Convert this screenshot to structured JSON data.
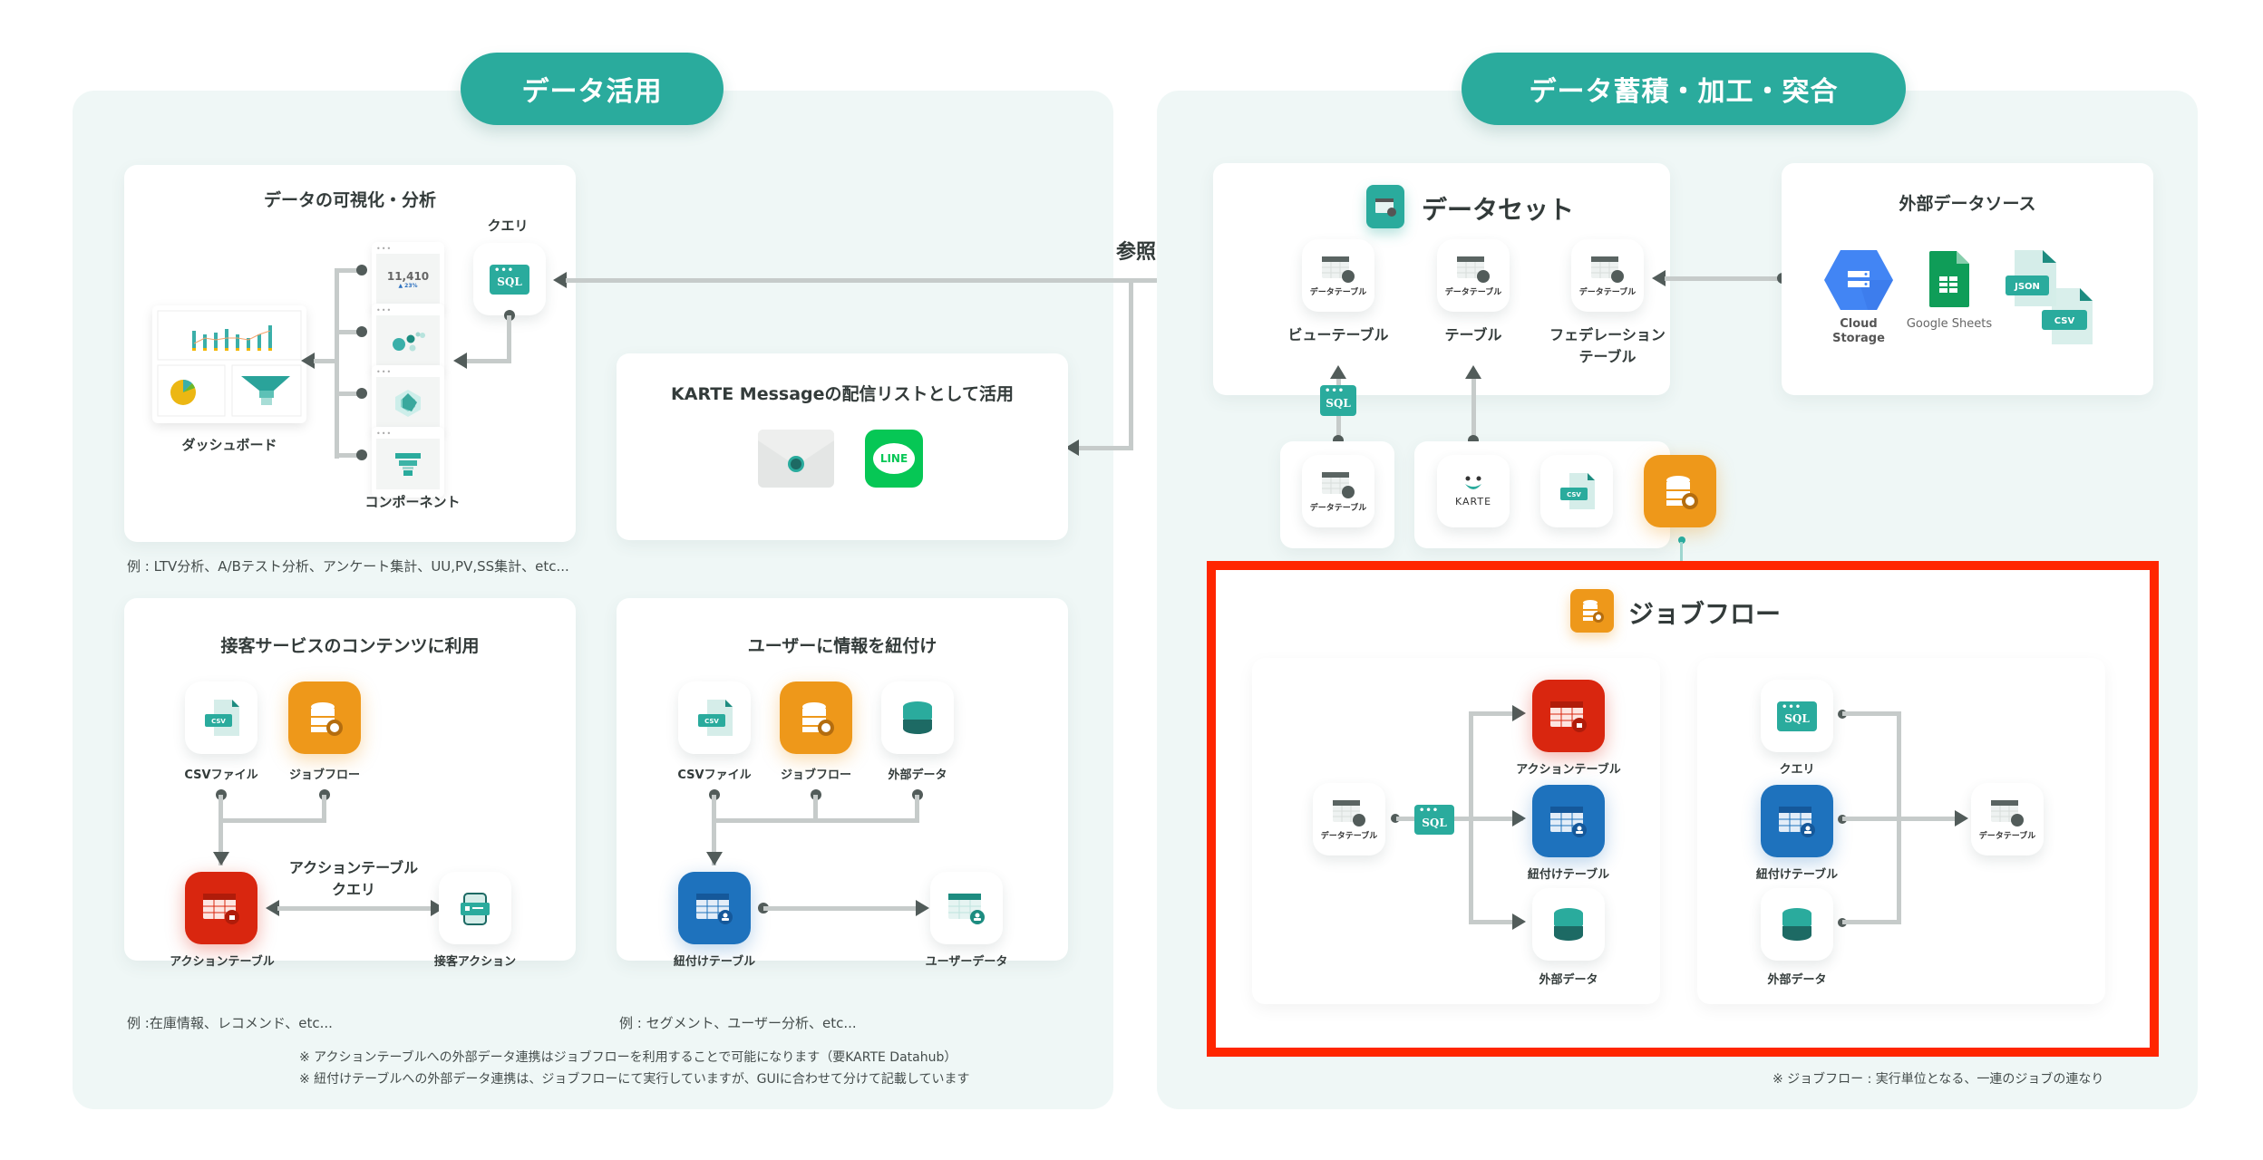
{
  "left_section": {
    "title": "データ活用",
    "viz_card": {
      "title": "データの可視化・分析",
      "query_label": "クエリ",
      "dashboard_label": "ダッシュボード",
      "components_label": "コンポーネント",
      "kpi_value": "11,410",
      "kpi_delta": "▲ 23%",
      "sql_text": "SQL",
      "note": "例 : LTV分析、A/Bテスト分析、アンケート集計、UU,PV,SS集計、etc..."
    },
    "reference_label": "参照",
    "message_card": {
      "title": "KARTE Messageの配信リストとして活用",
      "line_text": "LINE"
    },
    "service_card": {
      "title": "接客サービスのコンテンツに利用",
      "csv_file_label": "CSVファイル",
      "jobflow_label": "ジョブフロー",
      "action_table_label": "アクションテーブル",
      "query_caption_line1": "アクションテーブル",
      "query_caption_line2": "クエリ",
      "action_label": "接客アクション",
      "csv_badge": "CSV",
      "note": "例 :在庫情報、レコメンド、etc..."
    },
    "user_card": {
      "title": "ユーザーに情報を紐付け",
      "csv_file_label": "CSVファイル",
      "jobflow_label": "ジョブフロー",
      "external_label": "外部データ",
      "linked_table_label": "紐付けテーブル",
      "user_data_label": "ユーザーデータ",
      "csv_badge": "CSV",
      "note": "例 : セグメント、ユーザー分析、etc..."
    },
    "footnotes": [
      "※ アクションテーブルへの外部データ連携はジョブフローを利用することで可能になります（要KARTE Datahub）",
      "※ 紐付けテーブルへの外部データ連携は、ジョブフローにて実行していますが、GUIに合わせて分けて記載しています"
    ]
  },
  "right_section": {
    "title": "データ蓄積・加工・突合",
    "dataset_card": {
      "title": "データセット",
      "tile_sub": "データテーブル",
      "items": [
        {
          "label": "ビューテーブル"
        },
        {
          "label": "テーブル"
        },
        {
          "label": "フェデレーション\nテーブル",
          "line1": "フェデレーション",
          "line2": "テーブル"
        }
      ]
    },
    "external_sources": {
      "title": "外部データソース",
      "cloud_storage_line1": "Cloud",
      "cloud_storage_line2": "Storage",
      "google_sheets": "Google Sheets",
      "json_badge": "JSON",
      "csv_badge": "CSV"
    },
    "sources_row": {
      "datatable_sub": "データテーブル",
      "karte_label": "KARTE",
      "csv_badge": "CSV",
      "sql_text": "SQL"
    },
    "jobflow": {
      "title": "ジョブフロー",
      "left_flow": {
        "source_sub": "データテーブル",
        "sql_text": "SQL",
        "targets": [
          "アクションテーブル",
          "紐付けテーブル",
          "外部データ"
        ]
      },
      "right_flow": {
        "sources": [
          "クエリ",
          "紐付けテーブル",
          "外部データ"
        ],
        "sql_text": "SQL",
        "target_sub": "データテーブル"
      },
      "note": "※ ジョブフロー : 実行単位となる、一連のジョブの連なり"
    }
  },
  "colors": {
    "teal": "#2aab9d",
    "orange": "#ee981a",
    "red": "#d9260f",
    "blue": "#1e72bd",
    "highlight_border": "#ff2600",
    "section_bg": "#eff7f6",
    "line_green": "#06c755"
  }
}
